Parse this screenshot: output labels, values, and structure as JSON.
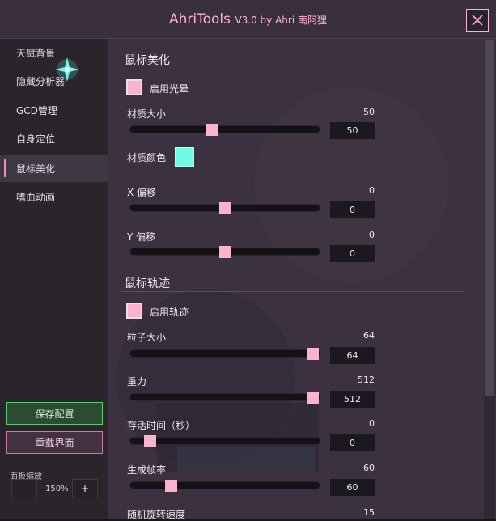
{
  "title": {
    "app": "AhriTools",
    "version": "V3.0 by Ahri 南阿狸"
  },
  "sidebar": {
    "items": [
      {
        "label": "天赋背景"
      },
      {
        "label": "隐藏分析器"
      },
      {
        "label": "GCD管理"
      },
      {
        "label": "自身定位"
      },
      {
        "label": "鼠标美化"
      },
      {
        "label": "嗜血动画"
      }
    ],
    "active_index": 4,
    "save_label": "保存配置",
    "reload_label": "重载界面",
    "zoom_label": "面板缩放",
    "zoom_minus": "-",
    "zoom_plus": "+",
    "zoom_value": "150%"
  },
  "sections": {
    "beautify": {
      "title": "鼠标美化",
      "enable_label": "启用光晕",
      "enabled": true,
      "size_label": "材质大小",
      "size_value": "50",
      "size_input": "50",
      "color_label": "材质颜色",
      "color_hex": "#70fbe8",
      "xoffset_label": "X 偏移",
      "xoffset_value": "0",
      "xoffset_input": "0",
      "yoffset_label": "Y 偏移",
      "yoffset_value": "0",
      "yoffset_input": "0"
    },
    "trail": {
      "title": "鼠标轨迹",
      "enable_label": "启用轨迹",
      "enabled": true,
      "particle_label": "粒子大小",
      "particle_value": "64",
      "particle_input": "64",
      "gravity_label": "重力",
      "gravity_value": "512",
      "gravity_input": "512",
      "life_label": "存活时间（秒）",
      "life_value": "0",
      "life_input": "0",
      "rate_label": "生成帧率",
      "rate_value": "60",
      "rate_input": "60",
      "spin_label": "随机旋转速度",
      "spin_value": "15"
    }
  },
  "sliders": {
    "size": 0.43,
    "xoffset": 0.5,
    "yoffset": 0.5,
    "particle": 0.99,
    "gravity": 0.99,
    "life": 0.08,
    "rate": 0.2
  },
  "colors": {
    "accent_pink": "#fbb2cf",
    "title_pink": "#ffb0d6",
    "save_green": "#56d06c"
  }
}
